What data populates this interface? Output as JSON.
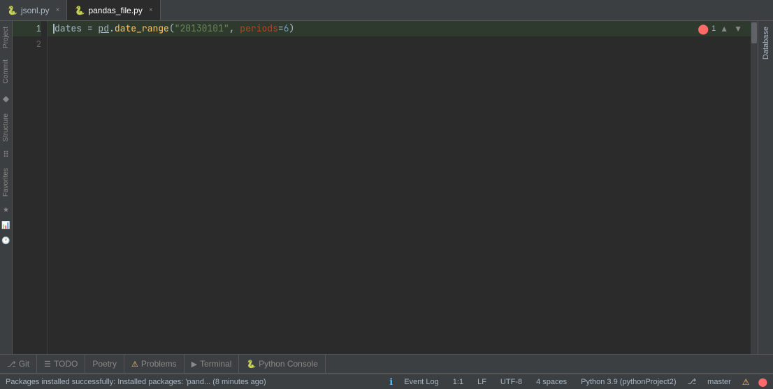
{
  "tabs": [
    {
      "label": "jsonl.py",
      "active": false,
      "icon": "🐍"
    },
    {
      "label": "pandas_file.py",
      "active": true,
      "icon": "🐍"
    }
  ],
  "editor": {
    "lines": [
      {
        "num": 1,
        "highlighted": true,
        "tokens": [
          {
            "type": "var",
            "text": "dates"
          },
          {
            "type": "op",
            "text": " = "
          },
          {
            "type": "module",
            "text": "pd"
          },
          {
            "type": "op",
            "text": "."
          },
          {
            "type": "method",
            "text": "date_range"
          },
          {
            "type": "paren",
            "text": "("
          },
          {
            "type": "string",
            "text": "\"20130101\""
          },
          {
            "type": "op",
            "text": ", "
          },
          {
            "type": "param",
            "text": "periods"
          },
          {
            "type": "op",
            "text": "="
          },
          {
            "type": "num",
            "text": "6"
          },
          {
            "type": "paren",
            "text": ")"
          }
        ]
      },
      {
        "num": 2,
        "highlighted": false,
        "tokens": []
      }
    ],
    "error_count": "1",
    "cursor_line": 1,
    "cursor_col": 1
  },
  "right_sidebar": {
    "label": "Database"
  },
  "left_labels": [
    {
      "label": "Project"
    },
    {
      "label": "Commit"
    },
    {
      "label": "Structure"
    },
    {
      "label": "Favorites"
    }
  ],
  "bottom_tabs": [
    {
      "label": "Git",
      "icon": "⎇"
    },
    {
      "label": "TODO",
      "icon": "☰"
    },
    {
      "label": "Poetry",
      "icon": ""
    },
    {
      "label": "Problems",
      "icon": "⚠"
    },
    {
      "label": "Terminal",
      "icon": "▶"
    },
    {
      "label": "Python Console",
      "icon": "🐍"
    }
  ],
  "status_bar": {
    "package_message": "Packages installed successfully: Installed packages: 'pand... (8 minutes ago)",
    "position": "1:1",
    "line_ending": "LF",
    "encoding": "UTF-8",
    "indent": "4 spaces",
    "python_version": "Python 3.9 (pythonProject2)",
    "git_branch": "master",
    "event_log": "Event Log",
    "info_icon": "ℹ"
  }
}
